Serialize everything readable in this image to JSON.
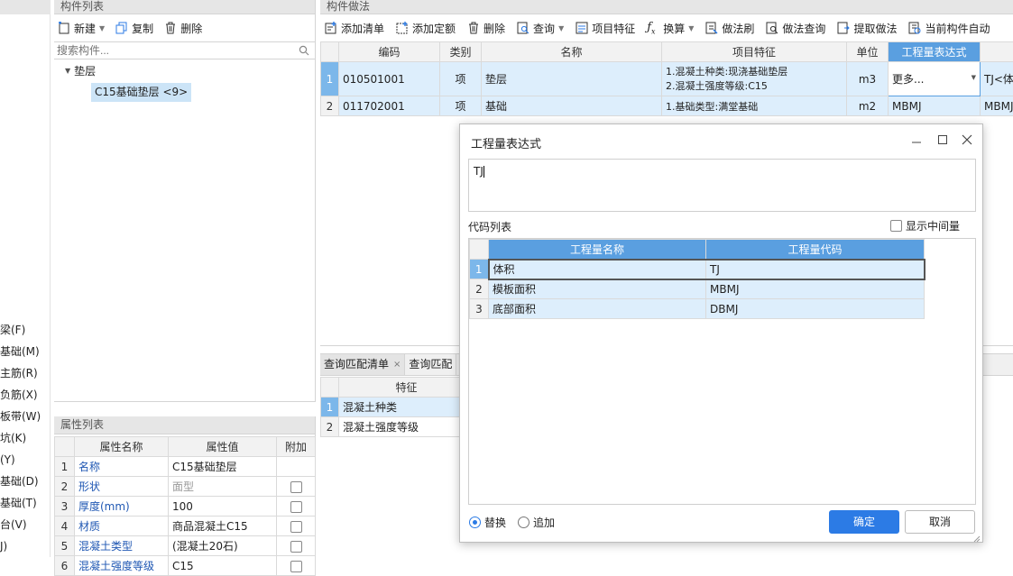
{
  "left_nav": {
    "items": [
      "梁(F)",
      "基础(M)",
      "主筋(R)",
      "负筋(X)",
      "板带(W)",
      "坑(K)",
      "(Y)",
      "基础(D)",
      "基础(T)",
      "台(V)",
      "J)"
    ]
  },
  "component_list": {
    "title": "构件列表",
    "toolbar": {
      "new": "新建",
      "copy": "复制",
      "delete": "删除"
    },
    "search_placeholder": "搜索构件...",
    "tree": {
      "group": "垫层",
      "item": "C15基础垫层 <9>"
    }
  },
  "property_list": {
    "title": "属性列表",
    "headers": [
      "属性名称",
      "属性值",
      "附加"
    ],
    "rows": [
      {
        "n": "1",
        "name": "名称",
        "value": "C15基础垫层",
        "check": false,
        "show_check": false
      },
      {
        "n": "2",
        "name": "形状",
        "value": "面型",
        "check": false,
        "show_check": true
      },
      {
        "n": "3",
        "name": "厚度(mm)",
        "value": "100",
        "check": false,
        "show_check": true
      },
      {
        "n": "4",
        "name": "材质",
        "value": "商品混凝土C15",
        "check": false,
        "show_check": true
      },
      {
        "n": "5",
        "name": "混凝土类型",
        "value": "(混凝土20石)",
        "check": false,
        "show_check": true
      },
      {
        "n": "6",
        "name": "混凝土强度等级",
        "value": "C15",
        "check": false,
        "show_check": true
      }
    ]
  },
  "method_panel": {
    "title": "构件做法",
    "toolbar": [
      "添加清单",
      "添加定额",
      "删除",
      "查询",
      "项目特征",
      "换算",
      "做法刷",
      "做法查询",
      "提取做法",
      "当前构件自动"
    ],
    "headers": [
      "编码",
      "类别",
      "名称",
      "项目特征",
      "单位",
      "工程量表达式"
    ],
    "rows": [
      {
        "n": "1",
        "code": "010501001",
        "type": "项",
        "name": "垫层",
        "feature1": "1.混凝土种类:现浇基础垫层",
        "feature2": "2.混凝土强度等级:C15",
        "unit": "m3",
        "expr": "更多...",
        "extra": "TJ<体积"
      },
      {
        "n": "2",
        "code": "011702001",
        "type": "项",
        "name": "基础",
        "feature1": "1.基础类型:满堂基础",
        "feature2": "",
        "unit": "m2",
        "expr": "MBMJ",
        "extra": "MBMJ"
      }
    ]
  },
  "query_panel": {
    "tabs": [
      "查询匹配清单",
      "查询匹配"
    ],
    "header": "特征",
    "rows": [
      {
        "n": "1",
        "text": "混凝土种类"
      },
      {
        "n": "2",
        "text": "混凝土强度等级"
      }
    ]
  },
  "dialog": {
    "title": "工程量表达式",
    "expr_value": "TJ",
    "code_list_label": "代码列表",
    "show_intermediate": "显示中间量",
    "headers": [
      "工程量名称",
      "工程量代码"
    ],
    "rows": [
      {
        "n": "1",
        "name": "体积",
        "code": "TJ"
      },
      {
        "n": "2",
        "name": "模板面积",
        "code": "MBMJ"
      },
      {
        "n": "3",
        "name": "底部面积",
        "code": "DBMJ"
      }
    ],
    "radio_replace": "替换",
    "radio_append": "追加",
    "ok": "确定",
    "cancel": "取消"
  }
}
